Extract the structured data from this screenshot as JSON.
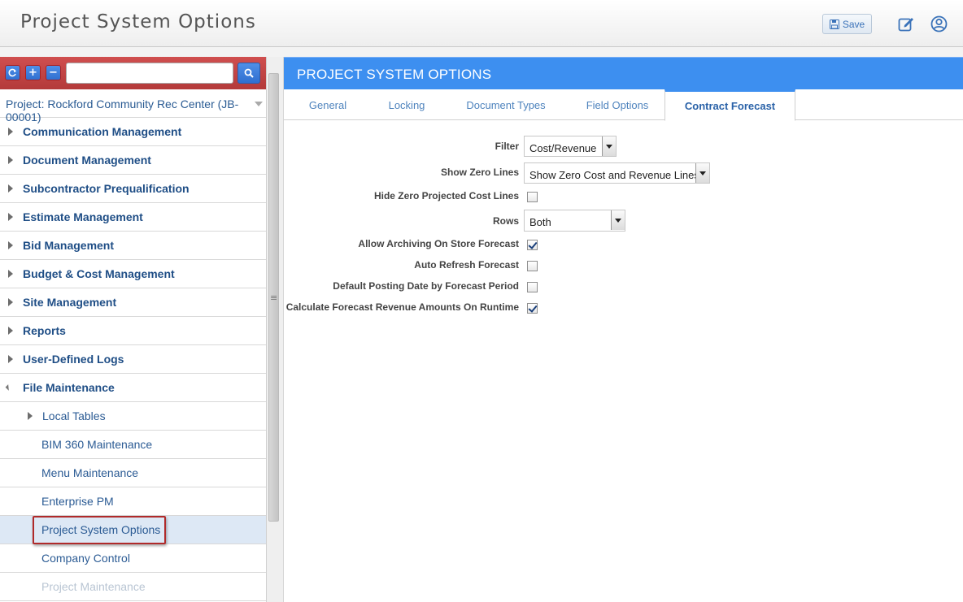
{
  "app": {
    "title": "Project System Options"
  },
  "toolbar": {
    "save_label": "Save"
  },
  "tree_search": {
    "placeholder": ""
  },
  "project_selector": {
    "value": "Project: Rockford Community Rec Center (JB-00001)"
  },
  "tree": {
    "items": [
      {
        "label": "Communication Management",
        "level": "top",
        "expanded": false
      },
      {
        "label": "Document Management",
        "level": "top",
        "expanded": false
      },
      {
        "label": "Subcontractor Prequalification",
        "level": "top",
        "expanded": false
      },
      {
        "label": "Estimate Management",
        "level": "top",
        "expanded": false
      },
      {
        "label": "Bid Management",
        "level": "top",
        "expanded": false
      },
      {
        "label": "Budget & Cost Management",
        "level": "top",
        "expanded": false
      },
      {
        "label": "Site Management",
        "level": "top",
        "expanded": false
      },
      {
        "label": "Reports",
        "level": "top",
        "expanded": false
      },
      {
        "label": "User-Defined Logs",
        "level": "top",
        "expanded": false
      },
      {
        "label": "File Maintenance",
        "level": "top",
        "expanded": true
      },
      {
        "label": "Local Tables",
        "level": "sub",
        "expanded": false
      },
      {
        "label": "BIM 360 Maintenance",
        "level": "sub"
      },
      {
        "label": "Menu Maintenance",
        "level": "sub"
      },
      {
        "label": "Enterprise PM",
        "level": "sub"
      },
      {
        "label": "Project System Options",
        "level": "sub",
        "selected": true
      },
      {
        "label": "Company Control",
        "level": "sub"
      },
      {
        "label": "Project Maintenance",
        "level": "sub",
        "faded": true
      }
    ]
  },
  "panel": {
    "header": "PROJECT SYSTEM OPTIONS",
    "tabs": [
      {
        "label": "General"
      },
      {
        "label": "Locking"
      },
      {
        "label": "Document Types"
      },
      {
        "label": "Field Options"
      },
      {
        "label": "Contract Forecast",
        "active": true
      }
    ],
    "form": {
      "filter": {
        "label": "Filter",
        "value": "Cost/Revenue"
      },
      "show_zero_lines": {
        "label": "Show Zero Lines",
        "value": "Show Zero Cost and Revenue Lines"
      },
      "hide_zero_projected": {
        "label": "Hide Zero Projected Cost Lines",
        "checked": false
      },
      "rows": {
        "label": "Rows",
        "value": "Both"
      },
      "allow_archiving": {
        "label": "Allow Archiving On Store Forecast",
        "checked": true
      },
      "auto_refresh": {
        "label": "Auto Refresh Forecast",
        "checked": false
      },
      "default_posting": {
        "label": "Default Posting Date by Forecast Period",
        "checked": false
      },
      "calculate_revenue": {
        "label": "Calculate Forecast Revenue Amounts On Runtime",
        "checked": true
      }
    }
  },
  "colors": {
    "accent": "#3d8ff0",
    "toolbar_red": "#b33a3a",
    "link": "#1f4e86",
    "selected_bg": "#dde8f5"
  }
}
